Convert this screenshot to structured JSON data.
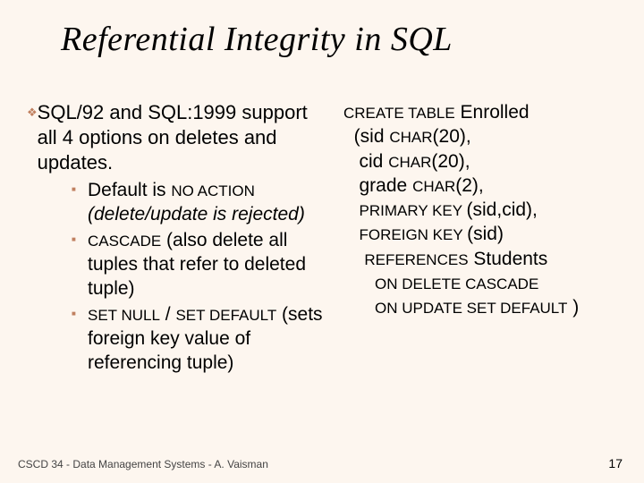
{
  "title": "Referential Integrity in SQL",
  "lead": "SQL/92 and SQL:1999 support all 4 options on deletes and updates.",
  "sub1_a": "Default is ",
  "sub1_b": "NO ACTION",
  "sub1_c": "(delete/update is rejected)",
  "sub2_a": "CASCADE",
  "sub2_b": "  (also delete all tuples that refer to deleted tuple)",
  "sub3_a": "SET NULL",
  "sub3_b": " / ",
  "sub3_c": "SET DEFAULT",
  "sub3_d": "(sets foreign key value of referencing tuple)",
  "code": {
    "l1a": "CREATE TABLE",
    "l1b": " Enrolled",
    "l2a": "  (sid ",
    "l2b": "CHAR",
    "l2c": "(20),",
    "l3a": "   cid ",
    "l3b": "CHAR",
    "l3c": "(20),",
    "l4a": "   grade ",
    "l4b": "CHAR",
    "l4c": "(2),",
    "l5a": "   ",
    "l5b": "PRIMARY KEY ",
    "l5c": " (sid,cid),",
    "l6a": "   ",
    "l6b": "FOREIGN KEY ",
    "l6c": "(sid)",
    "l7a": "    ",
    "l7b": "REFERENCES",
    "l7c": " Students",
    "l8a": "      ",
    "l8b": "ON DELETE CASCADE",
    "l9a": "      ",
    "l9b": "ON UPDATE SET DEFAULT",
    "l9c": " )"
  },
  "footer": "CSCD 34 - Data Management Systems - A. Vaisman",
  "pagenum": "17"
}
